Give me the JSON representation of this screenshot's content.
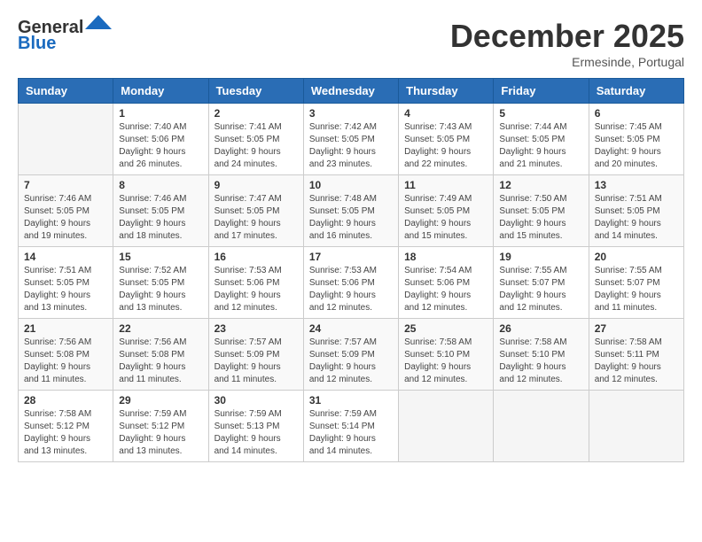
{
  "header": {
    "logo_general": "General",
    "logo_blue": "Blue",
    "month": "December 2025",
    "location": "Ermesinde, Portugal"
  },
  "days_of_week": [
    "Sunday",
    "Monday",
    "Tuesday",
    "Wednesday",
    "Thursday",
    "Friday",
    "Saturday"
  ],
  "weeks": [
    [
      {
        "day": "",
        "info": ""
      },
      {
        "day": "1",
        "info": "Sunrise: 7:40 AM\nSunset: 5:06 PM\nDaylight: 9 hours\nand 26 minutes."
      },
      {
        "day": "2",
        "info": "Sunrise: 7:41 AM\nSunset: 5:05 PM\nDaylight: 9 hours\nand 24 minutes."
      },
      {
        "day": "3",
        "info": "Sunrise: 7:42 AM\nSunset: 5:05 PM\nDaylight: 9 hours\nand 23 minutes."
      },
      {
        "day": "4",
        "info": "Sunrise: 7:43 AM\nSunset: 5:05 PM\nDaylight: 9 hours\nand 22 minutes."
      },
      {
        "day": "5",
        "info": "Sunrise: 7:44 AM\nSunset: 5:05 PM\nDaylight: 9 hours\nand 21 minutes."
      },
      {
        "day": "6",
        "info": "Sunrise: 7:45 AM\nSunset: 5:05 PM\nDaylight: 9 hours\nand 20 minutes."
      }
    ],
    [
      {
        "day": "7",
        "info": "Sunrise: 7:46 AM\nSunset: 5:05 PM\nDaylight: 9 hours\nand 19 minutes."
      },
      {
        "day": "8",
        "info": "Sunrise: 7:46 AM\nSunset: 5:05 PM\nDaylight: 9 hours\nand 18 minutes."
      },
      {
        "day": "9",
        "info": "Sunrise: 7:47 AM\nSunset: 5:05 PM\nDaylight: 9 hours\nand 17 minutes."
      },
      {
        "day": "10",
        "info": "Sunrise: 7:48 AM\nSunset: 5:05 PM\nDaylight: 9 hours\nand 16 minutes."
      },
      {
        "day": "11",
        "info": "Sunrise: 7:49 AM\nSunset: 5:05 PM\nDaylight: 9 hours\nand 15 minutes."
      },
      {
        "day": "12",
        "info": "Sunrise: 7:50 AM\nSunset: 5:05 PM\nDaylight: 9 hours\nand 15 minutes."
      },
      {
        "day": "13",
        "info": "Sunrise: 7:51 AM\nSunset: 5:05 PM\nDaylight: 9 hours\nand 14 minutes."
      }
    ],
    [
      {
        "day": "14",
        "info": "Sunrise: 7:51 AM\nSunset: 5:05 PM\nDaylight: 9 hours\nand 13 minutes."
      },
      {
        "day": "15",
        "info": "Sunrise: 7:52 AM\nSunset: 5:05 PM\nDaylight: 9 hours\nand 13 minutes."
      },
      {
        "day": "16",
        "info": "Sunrise: 7:53 AM\nSunset: 5:06 PM\nDaylight: 9 hours\nand 12 minutes."
      },
      {
        "day": "17",
        "info": "Sunrise: 7:53 AM\nSunset: 5:06 PM\nDaylight: 9 hours\nand 12 minutes."
      },
      {
        "day": "18",
        "info": "Sunrise: 7:54 AM\nSunset: 5:06 PM\nDaylight: 9 hours\nand 12 minutes."
      },
      {
        "day": "19",
        "info": "Sunrise: 7:55 AM\nSunset: 5:07 PM\nDaylight: 9 hours\nand 12 minutes."
      },
      {
        "day": "20",
        "info": "Sunrise: 7:55 AM\nSunset: 5:07 PM\nDaylight: 9 hours\nand 11 minutes."
      }
    ],
    [
      {
        "day": "21",
        "info": "Sunrise: 7:56 AM\nSunset: 5:08 PM\nDaylight: 9 hours\nand 11 minutes."
      },
      {
        "day": "22",
        "info": "Sunrise: 7:56 AM\nSunset: 5:08 PM\nDaylight: 9 hours\nand 11 minutes."
      },
      {
        "day": "23",
        "info": "Sunrise: 7:57 AM\nSunset: 5:09 PM\nDaylight: 9 hours\nand 11 minutes."
      },
      {
        "day": "24",
        "info": "Sunrise: 7:57 AM\nSunset: 5:09 PM\nDaylight: 9 hours\nand 12 minutes."
      },
      {
        "day": "25",
        "info": "Sunrise: 7:58 AM\nSunset: 5:10 PM\nDaylight: 9 hours\nand 12 minutes."
      },
      {
        "day": "26",
        "info": "Sunrise: 7:58 AM\nSunset: 5:10 PM\nDaylight: 9 hours\nand 12 minutes."
      },
      {
        "day": "27",
        "info": "Sunrise: 7:58 AM\nSunset: 5:11 PM\nDaylight: 9 hours\nand 12 minutes."
      }
    ],
    [
      {
        "day": "28",
        "info": "Sunrise: 7:58 AM\nSunset: 5:12 PM\nDaylight: 9 hours\nand 13 minutes."
      },
      {
        "day": "29",
        "info": "Sunrise: 7:59 AM\nSunset: 5:12 PM\nDaylight: 9 hours\nand 13 minutes."
      },
      {
        "day": "30",
        "info": "Sunrise: 7:59 AM\nSunset: 5:13 PM\nDaylight: 9 hours\nand 14 minutes."
      },
      {
        "day": "31",
        "info": "Sunrise: 7:59 AM\nSunset: 5:14 PM\nDaylight: 9 hours\nand 14 minutes."
      },
      {
        "day": "",
        "info": ""
      },
      {
        "day": "",
        "info": ""
      },
      {
        "day": "",
        "info": ""
      }
    ]
  ]
}
